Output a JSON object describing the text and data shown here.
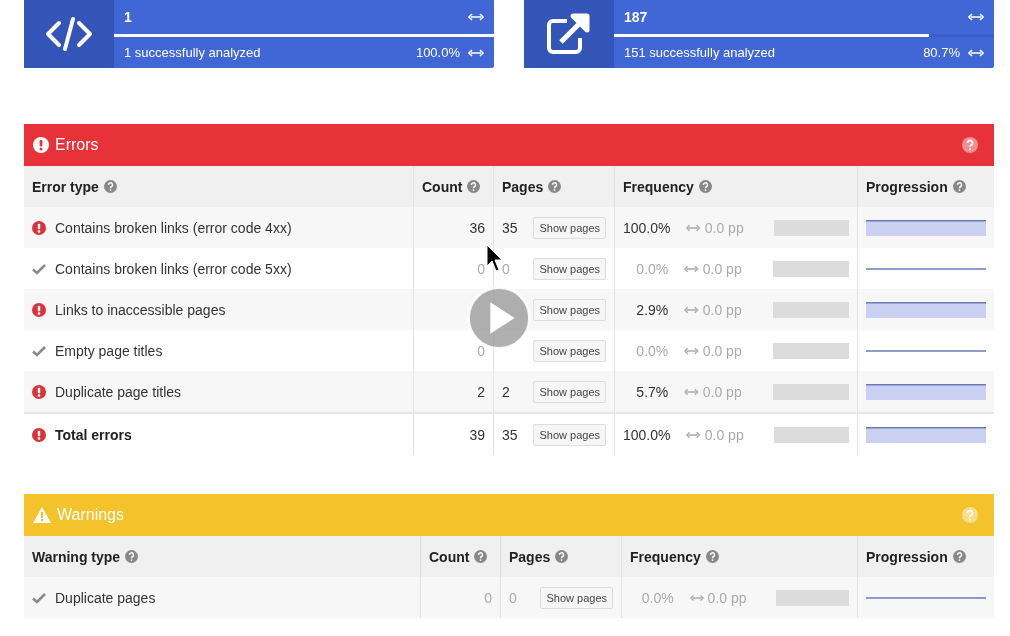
{
  "cards": [
    {
      "kind": "code",
      "value": "1",
      "level": 1.0,
      "analyzed": "1 successfully analyzed",
      "percent": "100.0%"
    },
    {
      "kind": "external-link",
      "value": "187",
      "level": 0.83,
      "analyzed": "151 successfully analyzed",
      "percent": "80.7%"
    }
  ],
  "panels": [
    {
      "kind": "error",
      "title": "Errors",
      "columns": [
        "Error type",
        "Count",
        "Pages",
        "Frequency",
        "Progression"
      ],
      "rows": [
        {
          "kind": "error",
          "label": "Contains broken links (error code 4xx)",
          "count": "36",
          "pages": "35",
          "button": "Show pages",
          "frequency": "100.0%",
          "change": "0.0 pp"
        },
        {
          "kind": "ok",
          "label": "Contains broken links (error code 5xx)",
          "count": "0",
          "pages": "0",
          "button": "Show pages",
          "frequency": "0.0%",
          "change": "0.0 pp"
        },
        {
          "kind": "error",
          "label": "Links to inaccessible pages",
          "button": "Show pages",
          "frequency": "2.9%",
          "change": "0.0 pp"
        },
        {
          "kind": "ok",
          "label": "Empty page titles",
          "count": "0",
          "button": "Show pages",
          "frequency": "0.0%",
          "change": "0.0 pp"
        },
        {
          "kind": "error",
          "label": "Duplicate page titles",
          "count": "2",
          "pages": "2",
          "button": "Show pages",
          "frequency": "5.7%",
          "change": "0.0 pp"
        }
      ],
      "total": {
        "kind": "error",
        "label": "Total errors",
        "count": "39",
        "pages": "35",
        "button": "Show pages",
        "frequency": "100.0%",
        "change": "0.0 pp"
      }
    },
    {
      "kind": "warning",
      "title": "Warnings",
      "columns": [
        "Warning type",
        "Count",
        "Pages",
        "Frequency",
        "Progression"
      ],
      "rows": [
        {
          "kind": "ok",
          "label": "Duplicate pages",
          "count": "0",
          "pages": "0",
          "button": "Show pages",
          "frequency": "0.0%",
          "change": "0.0 pp"
        }
      ]
    }
  ]
}
